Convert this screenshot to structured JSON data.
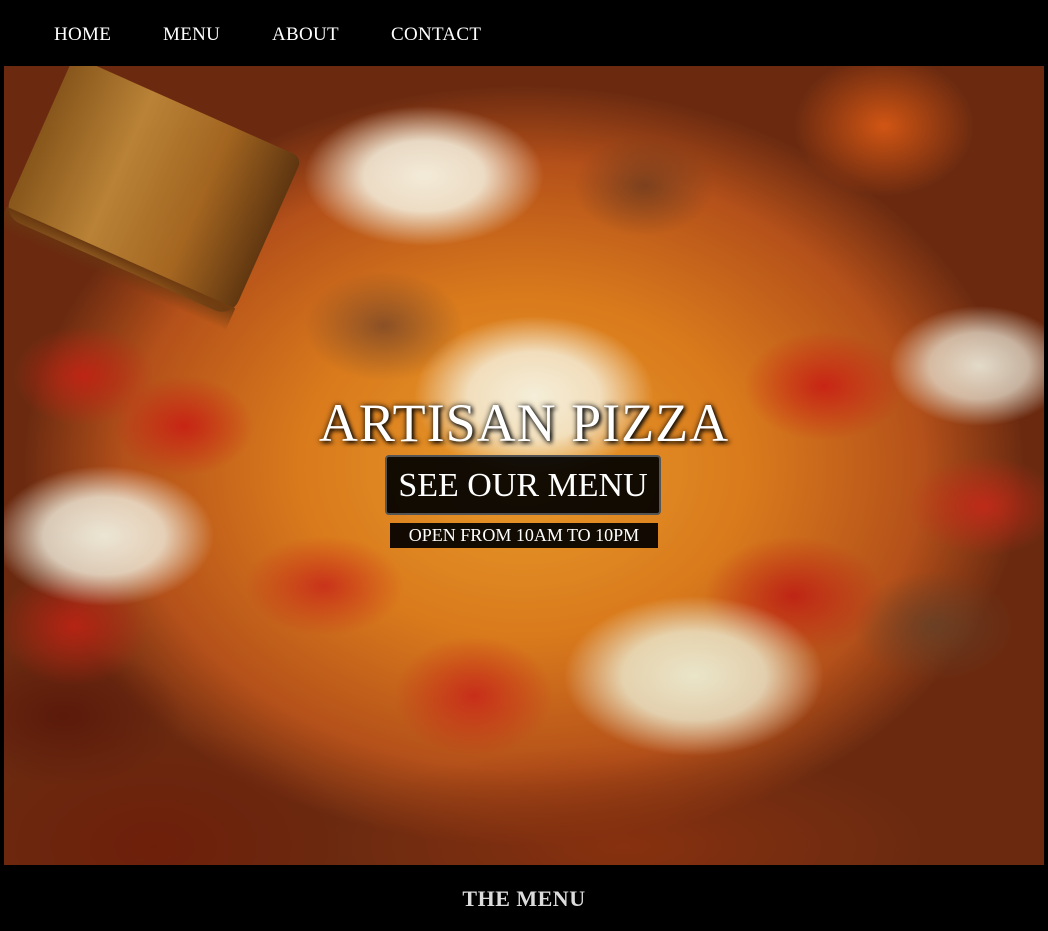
{
  "nav": {
    "items": [
      {
        "label": "HOME"
      },
      {
        "label": "MENU"
      },
      {
        "label": "ABOUT"
      },
      {
        "label": "CONTACT"
      }
    ]
  },
  "hero": {
    "title": "ARTISAN PIZZA",
    "button_label": "SEE OUR MENU",
    "hours": "OPEN FROM 10AM TO 10PM",
    "image_subject": "pizza-photo"
  },
  "menu_section": {
    "title": "THE MENU"
  },
  "colors": {
    "background": "#000000",
    "text": "#ffffff",
    "section_title": "#dcdcdc"
  }
}
